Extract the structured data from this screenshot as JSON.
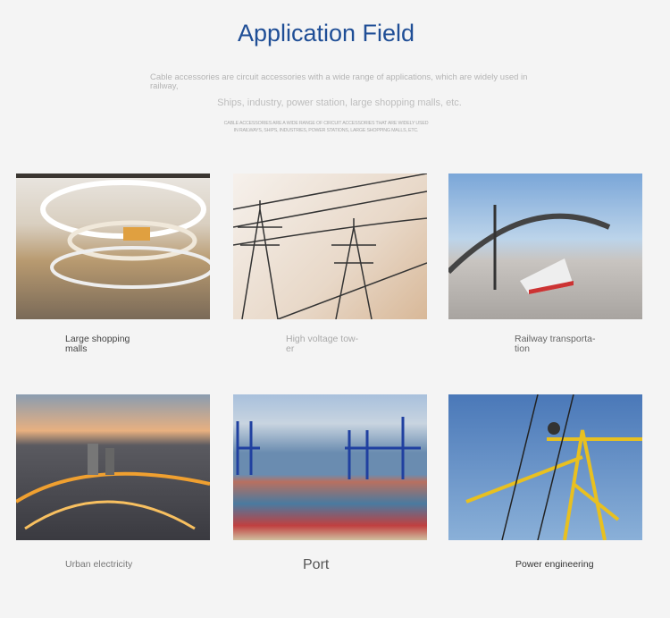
{
  "header": {
    "title": "Application Field",
    "desc1": "Cable accessories are circuit accessories with a wide range of applications, which are widely used in railway,",
    "desc2": "Ships, industry, power station, large shopping malls, etc.",
    "desc3_line1": "CABLE ACCESSORIES ARE A WIDE RANGE OF CIRCUIT ACCESSORIES THAT ARE WIDELY USED",
    "desc3_line2": "IN RAILWAYS, SHIPS, INDUSTRIES, POWER STATIONS, LARGE SHOPPING MALLS, ETC."
  },
  "items": [
    {
      "label": "Large shopping malls",
      "image": "shopping-mall-photo"
    },
    {
      "label": "High voltage tow-er",
      "image": "power-tower-photo"
    },
    {
      "label": "Railway transporta-tion",
      "image": "train-station-photo"
    },
    {
      "label": "Urban electricity",
      "image": "city-night-photo"
    },
    {
      "label": "Port",
      "image": "container-port-photo"
    },
    {
      "label": "Power engineering",
      "image": "lineman-tower-photo"
    }
  ],
  "colors": {
    "title": "#1f4e96",
    "background": "#f4f4f4"
  }
}
